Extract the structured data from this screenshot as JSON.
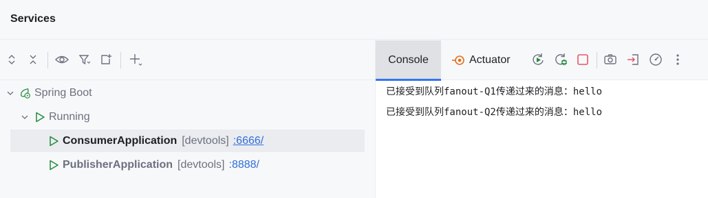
{
  "window": {
    "title": "Services"
  },
  "left_toolbar": {
    "icons": [
      "expand-all-icon",
      "collapse-all-icon",
      "eye-icon",
      "filter-icon",
      "new-tab-icon",
      "add-icon"
    ]
  },
  "tree": {
    "root": {
      "label": "Spring Boot",
      "icon": "spring-boot-icon"
    },
    "group": {
      "label": "Running",
      "icon": "run-icon"
    },
    "apps": [
      {
        "name": "ConsumerApplication",
        "tag": "[devtools]",
        "port": ":6666/",
        "selected": true
      },
      {
        "name": "PublisherApplication",
        "tag": "[devtools]",
        "port": ":8888/",
        "selected": false
      }
    ]
  },
  "right_toolbar": {
    "tabs": [
      {
        "label": "Console",
        "active": true
      },
      {
        "label": "Actuator",
        "active": false
      }
    ],
    "actions": [
      "rerun-icon",
      "rerun-debug-icon",
      "stop-icon",
      "screenshot-icon",
      "exit-icon",
      "dashboard-icon",
      "more-icon"
    ]
  },
  "console": {
    "lines": [
      "已接受到队列fanout-Q1传递过来的消息：hello",
      "已接受到队列fanout-Q2传递过来的消息：hello"
    ]
  },
  "colors": {
    "accent": "#3574f0",
    "run_green": "#208a3c",
    "stop_red": "#e55765",
    "actuator_orange": "#e66d17",
    "link_blue": "#2f6ed8"
  }
}
